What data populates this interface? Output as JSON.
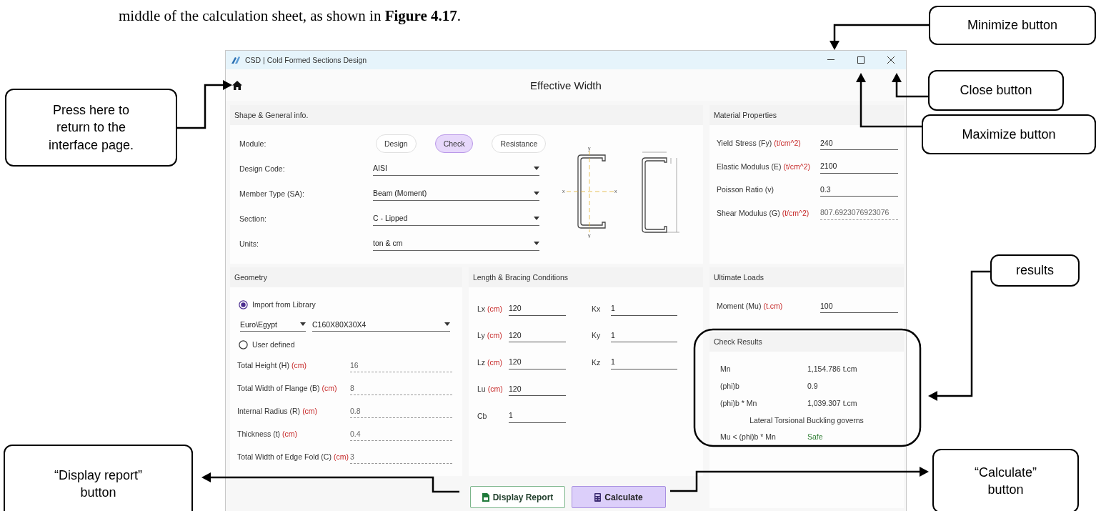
{
  "intro": "middle of the calculation sheet, as shown in **Figure 4.17**.",
  "window": {
    "title": "CSD | Cold Formed Sections Design"
  },
  "header": {
    "title": "Effective Width"
  },
  "shape": {
    "title": "Shape & General info.",
    "module_label": "Module:",
    "modules": [
      {
        "label": "Design",
        "selected": false
      },
      {
        "label": "Check",
        "selected": true
      },
      {
        "label": "Resistance",
        "selected": false
      }
    ],
    "dropdowns": [
      {
        "label": "Design Code:",
        "value": "AISI"
      },
      {
        "label": "Member Type (SA):",
        "value": "Beam (Moment)"
      },
      {
        "label": "Section:",
        "value": "C - Lipped"
      },
      {
        "label": "Units:",
        "value": "ton & cm"
      }
    ],
    "axis_labels": [
      "y",
      "x",
      "x",
      "y"
    ]
  },
  "material": {
    "title": "Material Properties",
    "fields": [
      {
        "label": "Yield Stress (Fy)",
        "unit": "(t/cm^2)",
        "value": "240",
        "readonly": false
      },
      {
        "label": "Elastic Modulus (E)",
        "unit": "(t/cm^2)",
        "value": "2100",
        "readonly": false
      },
      {
        "label": "Poisson Ratio (v)",
        "value": "0.3",
        "readonly": false
      },
      {
        "label": "Shear Modulus (G)",
        "unit": "(t/cm^2)",
        "value": "807.6923076923076",
        "readonly": true
      }
    ]
  },
  "geometry": {
    "title": "Geometry",
    "options": [
      {
        "label": "Import from Library",
        "selected": true
      },
      {
        "label": "User defined",
        "selected": false
      }
    ],
    "library": "Euro\\Egypt",
    "section": "C160X80X30X4",
    "fields": [
      {
        "label": "Total Height (H)",
        "unit": "(cm)",
        "value": "16",
        "readonly": true
      },
      {
        "label": "Total Width of Flange (B)",
        "unit": "(cm)",
        "value": "8",
        "readonly": true
      },
      {
        "label": "Internal Radius (R)",
        "unit": "(cm)",
        "value": "0.8",
        "readonly": true
      },
      {
        "label": "Thickness (t)",
        "unit": "(cm)",
        "value": "0.4",
        "readonly": true
      },
      {
        "label": "Total Width of Edge Fold (C)",
        "unit": "(cm)",
        "value": "3",
        "readonly": true
      }
    ]
  },
  "bracing": {
    "title": "Length & Bracing Conditions",
    "rows": [
      {
        "label": "Lx",
        "unit": "(cm)",
        "value": "120",
        "k_label": "Kx",
        "k_value": "1"
      },
      {
        "label": "Ly",
        "unit": "(cm)",
        "value": "120",
        "k_label": "Ky",
        "k_value": "1"
      },
      {
        "label": "Lz",
        "unit": "(cm)",
        "value": "120",
        "k_label": "Kz",
        "k_value": "1"
      },
      {
        "label": "Lu",
        "unit": "(cm)",
        "value": "120"
      },
      {
        "label": "Cb",
        "value": "1"
      }
    ]
  },
  "loads": {
    "title": "Ultimate Loads",
    "fields": [
      {
        "label": "Moment (Mu)",
        "unit": "(t.cm)",
        "value": "100"
      }
    ]
  },
  "results": {
    "title": "Check Results",
    "rows": [
      {
        "label": "Mn",
        "value": "1,154.786 t.cm"
      },
      {
        "label": "(phi)b",
        "value": "0.9"
      },
      {
        "label": "(phi)b * Mn",
        "value": "1,039.307 t.cm"
      }
    ],
    "note": "Lateral Torsional Buckling governs",
    "verdict": {
      "label": "Mu < (phi)b * Mn",
      "value": "Safe",
      "safe": true
    }
  },
  "buttons": [
    {
      "label": "Display Report",
      "kind": "report"
    },
    {
      "label": "Calculate",
      "kind": "calculate"
    }
  ],
  "callouts": [
    {
      "text": "Minimize button"
    },
    {
      "text": "Close button"
    },
    {
      "text": "Maximize button"
    },
    {
      "text": "Press here to return to the interface page."
    },
    {
      "text": "results"
    },
    {
      "text": "“Display report” button"
    },
    {
      "text": "“Calculate” button"
    }
  ]
}
